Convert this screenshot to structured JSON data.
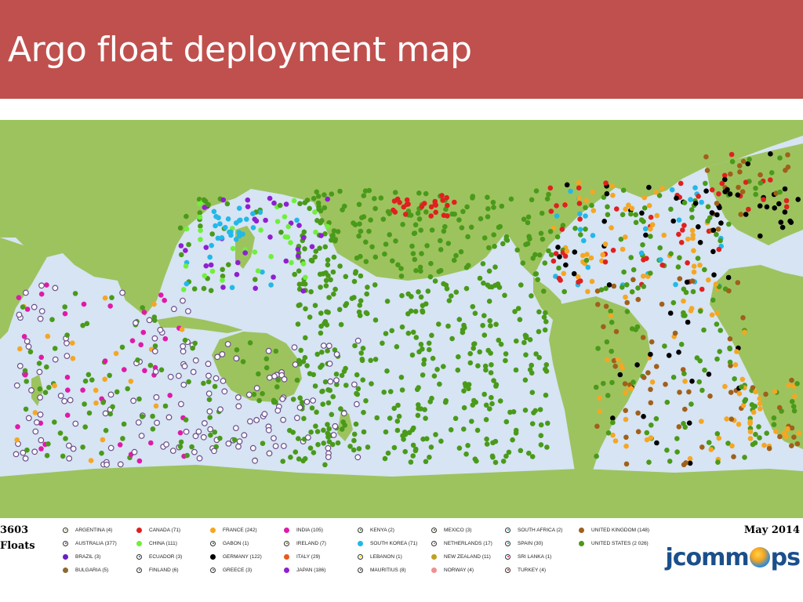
{
  "title": "Argo float deployment map",
  "float_count": "3603",
  "float_label": "Floats",
  "date": "May 2014",
  "logo": {
    "left": "jcomm",
    "right": "ps"
  },
  "colors": {
    "title_bar": "#c0504d",
    "ocean": "#d6e4f3",
    "land": "#9dc35f"
  },
  "legend": [
    {
      "label": "ARGENTINA (4)",
      "color": "#c8b400",
      "ring": true
    },
    {
      "label": "AUSTRALIA (377)",
      "color": "#6b4d8a",
      "ring": true
    },
    {
      "label": "BRAZIL (3)",
      "color": "#6a1fbf",
      "ring": false
    },
    {
      "label": "BULGARIA (5)",
      "color": "#8b6b2f",
      "ring": false
    },
    {
      "label": "CANADA (71)",
      "color": "#e02020",
      "ring": false
    },
    {
      "label": "CHINA (111)",
      "color": "#6ff03a",
      "ring": false
    },
    {
      "label": "ECUADOR (3)",
      "color": "#3a5fa8",
      "ring": true
    },
    {
      "label": "FINLAND (6)",
      "color": "#777777",
      "ring": true
    },
    {
      "label": "FRANCE (242)",
      "color": "#f5a623",
      "ring": false
    },
    {
      "label": "GABON (1)",
      "color": "#2f6b2f",
      "ring": true
    },
    {
      "label": "GERMANY (122)",
      "color": "#000000",
      "ring": false
    },
    {
      "label": "GREECE (3)",
      "color": "#3a7a7a",
      "ring": true
    },
    {
      "label": "INDIA (105)",
      "color": "#e01aa8",
      "ring": false
    },
    {
      "label": "IRELAND (7)",
      "color": "#5a8a1a",
      "ring": true
    },
    {
      "label": "ITALY (29)",
      "color": "#e85a1a",
      "ring": false
    },
    {
      "label": "JAPAN (186)",
      "color": "#8f1fd0",
      "ring": false
    },
    {
      "label": "KENYA (2)",
      "color": "#3a8a3a",
      "ring": true
    },
    {
      "label": "SOUTH KOREA (71)",
      "color": "#22b8e8",
      "ring": false
    },
    {
      "label": "LEBANON (1)",
      "color": "#e8d800",
      "ring": true
    },
    {
      "label": "MAURITIUS (8)",
      "color": "#7a5a3a",
      "ring": true
    },
    {
      "label": "MEXICO (3)",
      "color": "#556b2f",
      "ring": true
    },
    {
      "label": "NETHERLANDS (17)",
      "color": "#8a8a8a",
      "ring": true
    },
    {
      "label": "NEW ZEALAND (11)",
      "color": "#c0a020",
      "ring": false
    },
    {
      "label": "NORWAY (4)",
      "color": "#f09090",
      "ring": false
    },
    {
      "label": "SOUTH AFRICA (2)",
      "color": "#20b0b0",
      "ring": true
    },
    {
      "label": "SPAIN (30)",
      "color": "#1a9ab0",
      "ring": true
    },
    {
      "label": "SRI LANKA (1)",
      "color": "#d01a8a",
      "ring": true
    },
    {
      "label": "TURKEY (4)",
      "color": "#c01a1a",
      "ring": true
    },
    {
      "label": "UNITED KINGDOM (148)",
      "color": "#a0601a",
      "ring": false
    },
    {
      "label": "UNITED STATES (2 026)",
      "color": "#4a9a1a",
      "ring": false
    }
  ]
}
